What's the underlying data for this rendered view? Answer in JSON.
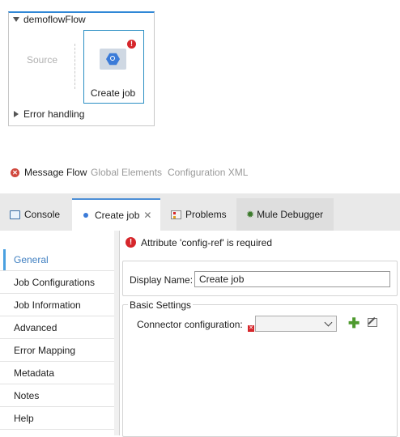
{
  "canvas": {
    "flow_name": "demoflowFlow",
    "source_label": "Source",
    "component_label": "Create job",
    "component_error_badge": "!",
    "error_handling_label": "Error handling"
  },
  "editor_tabs": {
    "message_flow": "Message Flow",
    "global_elements": "Global Elements",
    "configuration_xml": "Configuration XML"
  },
  "view_tabs": {
    "console": "Console",
    "create_job": "Create job",
    "problems": "Problems",
    "mule_debugger": "Mule Debugger"
  },
  "properties": {
    "error_message": "Attribute 'config-ref' is required",
    "sidebar": [
      {
        "label": "General",
        "active": true
      },
      {
        "label": "Job Configurations"
      },
      {
        "label": "Job Information"
      },
      {
        "label": "Advanced"
      },
      {
        "label": "Error Mapping"
      },
      {
        "label": "Metadata"
      },
      {
        "label": "Notes"
      },
      {
        "label": "Help"
      }
    ],
    "display_name_label": "Display Name:",
    "display_name_value": "Create job",
    "basic_settings_title": "Basic Settings",
    "connector_config_label": "Connector configuration:",
    "connector_config_value": ""
  },
  "colors": {
    "accent": "#2f87d6",
    "error": "#d6262b",
    "active_nav": "#3f7fc1",
    "add_green": "#4e9a2e"
  }
}
